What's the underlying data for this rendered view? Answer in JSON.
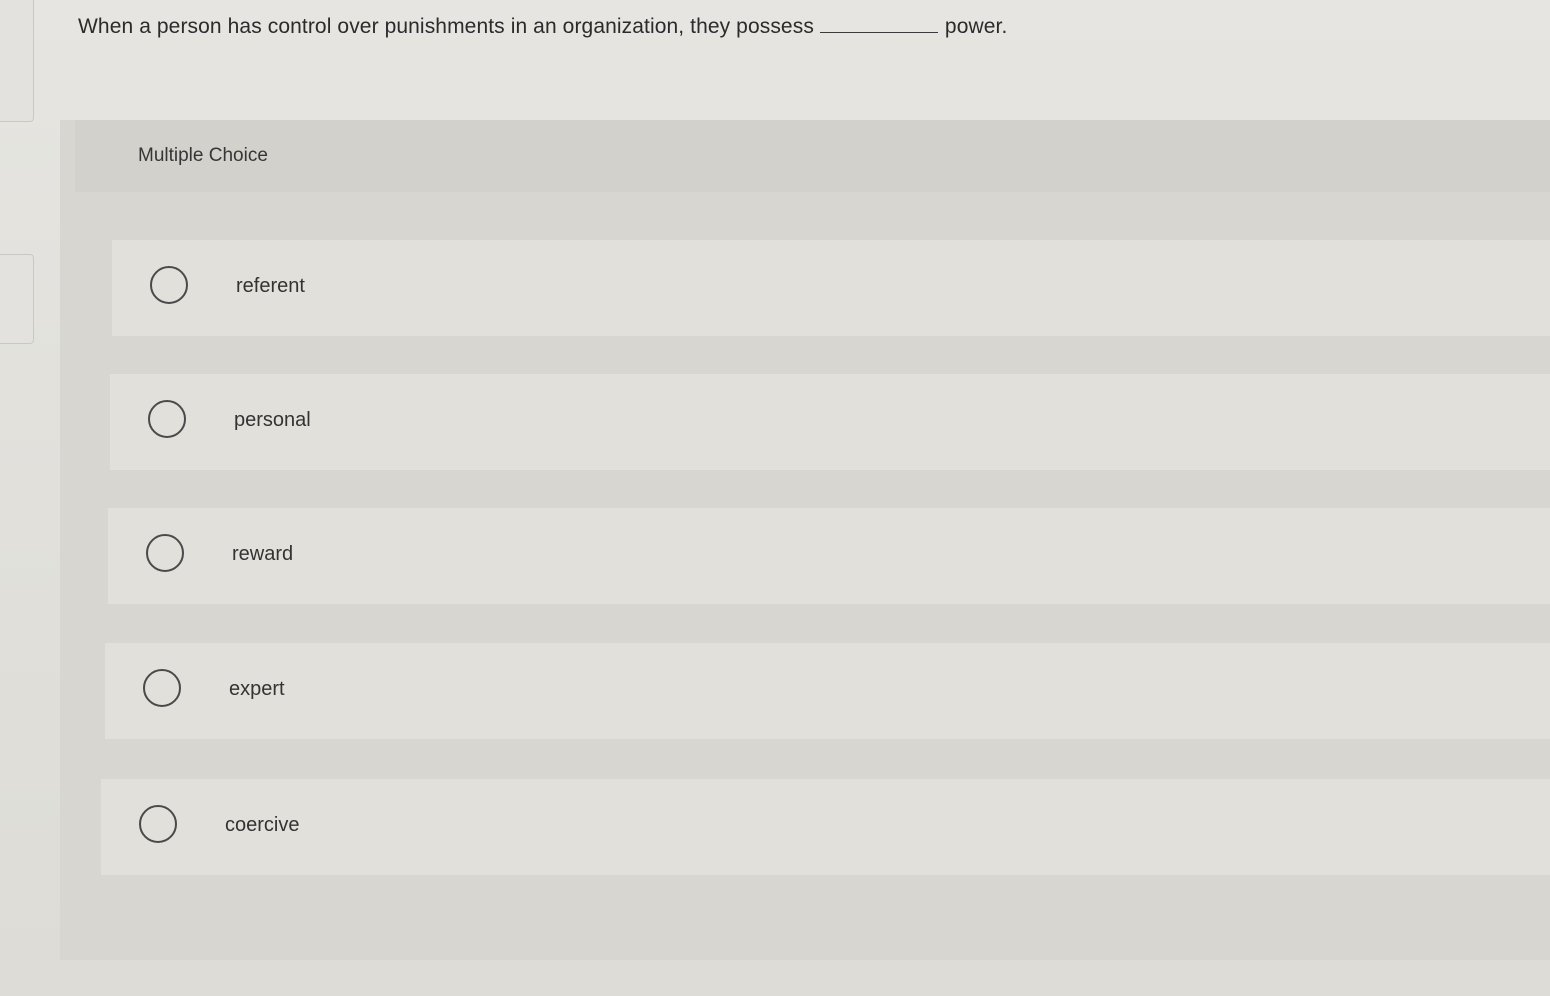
{
  "question": {
    "text_before": "When a person has control over punishments in an organization, they possess",
    "text_after": "power."
  },
  "multiple_choice": {
    "title": "Multiple Choice",
    "options": [
      {
        "label": "referent",
        "selected": false
      },
      {
        "label": "personal",
        "selected": false
      },
      {
        "label": "reward",
        "selected": false
      },
      {
        "label": "expert",
        "selected": false
      },
      {
        "label": "coercive",
        "selected": false
      }
    ]
  },
  "icons": {
    "radio": "radio-unselected-icon"
  }
}
